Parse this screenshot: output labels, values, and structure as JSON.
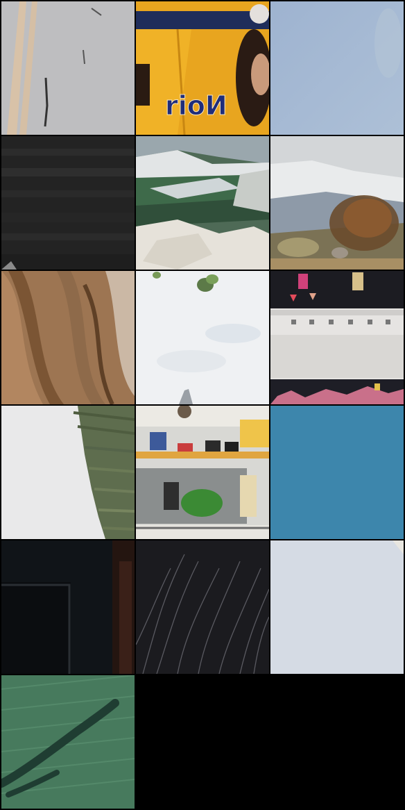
{
  "tiles": [
    {
      "id": 1,
      "subject": "road-lines",
      "jersey_text": ""
    },
    {
      "id": 2,
      "subject": "yellow-jersey-person",
      "jersey_text": "rioИ"
    },
    {
      "id": 3,
      "subject": "blue-sky"
    },
    {
      "id": 4,
      "subject": "dark-fabric"
    },
    {
      "id": 5,
      "subject": "mountain-valley"
    },
    {
      "id": 6,
      "subject": "mountain-shrub"
    },
    {
      "id": 7,
      "subject": "wood-grain"
    },
    {
      "id": 8,
      "subject": "white-sky-branch"
    },
    {
      "id": 9,
      "subject": "building-prayer-flags"
    },
    {
      "id": 10,
      "subject": "palm-frond"
    },
    {
      "id": 11,
      "subject": "temple-prayer-flags"
    },
    {
      "id": 12,
      "subject": "solid-blue"
    },
    {
      "id": 13,
      "subject": "dark-door-frame"
    },
    {
      "id": 14,
      "subject": "dark-grass"
    },
    {
      "id": 15,
      "subject": "pale-sky"
    },
    {
      "id": 16,
      "subject": "green-grass-shadow"
    }
  ]
}
